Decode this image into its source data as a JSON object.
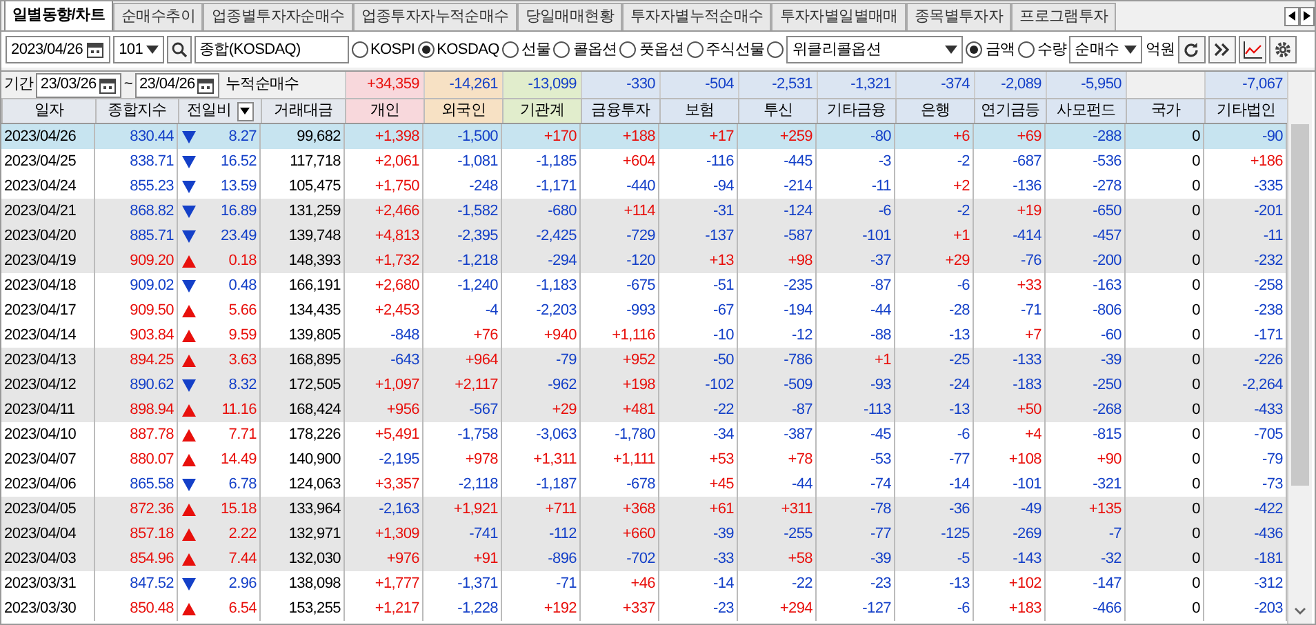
{
  "tabs": [
    {
      "label": "일별동향/차트",
      "selected": true
    },
    {
      "label": "순매수추이",
      "selected": false
    },
    {
      "label": "업종별투자자순매수",
      "selected": false
    },
    {
      "label": "업종투자자누적순매수",
      "selected": false
    },
    {
      "label": "당일매매현황",
      "selected": false
    },
    {
      "label": "투자자별누적순매수",
      "selected": false
    },
    {
      "label": "투자자별일별매매",
      "selected": false
    },
    {
      "label": "종목별투자자",
      "selected": false
    },
    {
      "label": "프로그램투자",
      "selected": false
    }
  ],
  "toolbar": {
    "date": "2023/04/26",
    "code": "101",
    "market_name": "종합(KOSDAQ)",
    "markets": [
      {
        "label": "KOSPI",
        "selected": false
      },
      {
        "label": "KOSDAQ",
        "selected": true
      },
      {
        "label": "선물",
        "selected": false
      },
      {
        "label": "콜옵션",
        "selected": false
      },
      {
        "label": "풋옵션",
        "selected": false
      },
      {
        "label": "주식선물",
        "selected": false
      },
      {
        "selected": false
      }
    ],
    "option_select": "위클리콜옵션",
    "units": [
      {
        "label": "금액",
        "selected": true
      },
      {
        "label": "수량",
        "selected": false
      }
    ],
    "mode_select": "순매수",
    "unit_label": "억원"
  },
  "period": {
    "label": "기간",
    "from": "23/03/26",
    "separator": "~",
    "to": "23/04/26",
    "totals_label": "누적순매수"
  },
  "table": {
    "columns": [
      {
        "label": "일자"
      },
      {
        "label": "종합지수"
      },
      {
        "label": "전일비",
        "kind": "dropdown"
      },
      {
        "label": "거래대금"
      },
      {
        "label": "개인",
        "color": "#f8d8dc"
      },
      {
        "label": "외국인",
        "color": "#f7e1c4"
      },
      {
        "label": "기관계",
        "color": "#e1edcc"
      },
      {
        "label": "금융투자",
        "color": "#dbe5f2"
      },
      {
        "label": "보험",
        "color": "#dbe5f2"
      },
      {
        "label": "투신",
        "color": "#dbe5f2"
      },
      {
        "label": "기타금융",
        "color": "#dbe5f2"
      },
      {
        "label": "은행",
        "color": "#dbe5f2"
      },
      {
        "label": "연기금등",
        "color": "#dbe5f2"
      },
      {
        "label": "사모펀드",
        "color": "#dbe5f2"
      },
      {
        "label": "국가",
        "color": "#dbe5f2"
      },
      {
        "label": "기타법인",
        "color": "#dbe5f2"
      }
    ],
    "totals": [
      {
        "value": "+34,359"
      },
      {
        "value": "-14,261"
      },
      {
        "value": "-13,099"
      },
      {
        "value": "-330"
      },
      {
        "value": "-504"
      },
      {
        "value": "-2,531"
      },
      {
        "value": "-1,321"
      },
      {
        "value": "-374"
      },
      {
        "value": "-2,089"
      },
      {
        "value": "-5,950"
      },
      {
        "blank": true
      },
      {
        "value": "-7,067"
      }
    ],
    "rows": [
      {
        "date": "2023/04/26",
        "index": "830.44",
        "up": false,
        "change": "8.27",
        "volume": "99,682",
        "values": [
          "+1,398",
          "-1,500",
          "+170",
          "+188",
          "+17",
          "+259",
          "-80",
          "+6",
          "+69",
          "-288",
          "0",
          "-90"
        ],
        "selected": true,
        "shaded": false
      },
      {
        "date": "2023/04/25",
        "index": "838.71",
        "up": false,
        "change": "16.52",
        "volume": "117,718",
        "values": [
          "+2,061",
          "-1,081",
          "-1,185",
          "+604",
          "-116",
          "-445",
          "-3",
          "-2",
          "-687",
          "-536",
          "0",
          "+186"
        ],
        "selected": false,
        "shaded": false
      },
      {
        "date": "2023/04/24",
        "index": "855.23",
        "up": false,
        "change": "13.59",
        "volume": "105,475",
        "values": [
          "+1,750",
          "-248",
          "-1,171",
          "-440",
          "-94",
          "-214",
          "-11",
          "+2",
          "-136",
          "-278",
          "0",
          "-335"
        ],
        "selected": false,
        "shaded": false
      },
      {
        "date": "2023/04/21",
        "index": "868.82",
        "up": false,
        "change": "16.89",
        "volume": "131,259",
        "values": [
          "+2,466",
          "-1,582",
          "-680",
          "+114",
          "-31",
          "-124",
          "-6",
          "-2",
          "+19",
          "-650",
          "0",
          "-201"
        ],
        "selected": false,
        "shaded": true
      },
      {
        "date": "2023/04/20",
        "index": "885.71",
        "up": false,
        "change": "23.49",
        "volume": "139,748",
        "values": [
          "+4,813",
          "-2,395",
          "-2,425",
          "-729",
          "-137",
          "-587",
          "-101",
          "+1",
          "-414",
          "-457",
          "0",
          "-11"
        ],
        "selected": false,
        "shaded": true
      },
      {
        "date": "2023/04/19",
        "index": "909.20",
        "up": true,
        "change": "0.18",
        "volume": "148,393",
        "values": [
          "+1,732",
          "-1,218",
          "-294",
          "-120",
          "+13",
          "+98",
          "-37",
          "+29",
          "-76",
          "-200",
          "0",
          "-232"
        ],
        "selected": false,
        "shaded": true
      },
      {
        "date": "2023/04/18",
        "index": "909.02",
        "up": false,
        "change": "0.48",
        "volume": "166,191",
        "values": [
          "+2,680",
          "-1,240",
          "-1,183",
          "-675",
          "-51",
          "-235",
          "-87",
          "-6",
          "+33",
          "-163",
          "0",
          "-258"
        ],
        "selected": false,
        "shaded": false
      },
      {
        "date": "2023/04/17",
        "index": "909.50",
        "up": true,
        "change": "5.66",
        "volume": "134,435",
        "values": [
          "+2,453",
          "-4",
          "-2,203",
          "-993",
          "-67",
          "-194",
          "-44",
          "-28",
          "-71",
          "-806",
          "0",
          "-238"
        ],
        "selected": false,
        "shaded": false
      },
      {
        "date": "2023/04/14",
        "index": "903.84",
        "up": true,
        "change": "9.59",
        "volume": "139,805",
        "values": [
          "-848",
          "+76",
          "+940",
          "+1,116",
          "-10",
          "-12",
          "-88",
          "-13",
          "+7",
          "-60",
          "0",
          "-171"
        ],
        "selected": false,
        "shaded": false
      },
      {
        "date": "2023/04/13",
        "index": "894.25",
        "up": true,
        "change": "3.63",
        "volume": "168,895",
        "values": [
          "-643",
          "+964",
          "-79",
          "+952",
          "-50",
          "-786",
          "+1",
          "-25",
          "-133",
          "-39",
          "0",
          "-226"
        ],
        "selected": false,
        "shaded": true
      },
      {
        "date": "2023/04/12",
        "index": "890.62",
        "up": false,
        "change": "8.32",
        "volume": "172,505",
        "values": [
          "+1,097",
          "+2,117",
          "-962",
          "+198",
          "-102",
          "-509",
          "-93",
          "-24",
          "-183",
          "-250",
          "0",
          "-2,264"
        ],
        "selected": false,
        "shaded": true
      },
      {
        "date": "2023/04/11",
        "index": "898.94",
        "up": true,
        "change": "11.16",
        "volume": "168,424",
        "values": [
          "+956",
          "-567",
          "+29",
          "+481",
          "-22",
          "-87",
          "-113",
          "-13",
          "+50",
          "-268",
          "0",
          "-433"
        ],
        "selected": false,
        "shaded": true
      },
      {
        "date": "2023/04/10",
        "index": "887.78",
        "up": true,
        "change": "7.71",
        "volume": "178,226",
        "values": [
          "+5,491",
          "-1,758",
          "-3,063",
          "-1,780",
          "-34",
          "-387",
          "-45",
          "-6",
          "+4",
          "-815",
          "0",
          "-705"
        ],
        "selected": false,
        "shaded": false
      },
      {
        "date": "2023/04/07",
        "index": "880.07",
        "up": true,
        "change": "14.49",
        "volume": "140,900",
        "values": [
          "-2,195",
          "+978",
          "+1,311",
          "+1,111",
          "+53",
          "+78",
          "-53",
          "-77",
          "+108",
          "+90",
          "0",
          "-79"
        ],
        "selected": false,
        "shaded": false
      },
      {
        "date": "2023/04/06",
        "index": "865.58",
        "up": false,
        "change": "6.78",
        "volume": "124,063",
        "values": [
          "+3,357",
          "-2,118",
          "-1,187",
          "-678",
          "+45",
          "-44",
          "-74",
          "-14",
          "-101",
          "-321",
          "0",
          "-73"
        ],
        "selected": false,
        "shaded": false
      },
      {
        "date": "2023/04/05",
        "index": "872.36",
        "up": true,
        "change": "15.18",
        "volume": "133,964",
        "values": [
          "-2,163",
          "+1,921",
          "+711",
          "+368",
          "+61",
          "+311",
          "-78",
          "-36",
          "-49",
          "+135",
          "0",
          "-422"
        ],
        "selected": false,
        "shaded": true
      },
      {
        "date": "2023/04/04",
        "index": "857.18",
        "up": true,
        "change": "2.22",
        "volume": "132,971",
        "values": [
          "+1,309",
          "-741",
          "-112",
          "+660",
          "-39",
          "-255",
          "-77",
          "-125",
          "-269",
          "-7",
          "0",
          "-436"
        ],
        "selected": false,
        "shaded": true
      },
      {
        "date": "2023/04/03",
        "index": "854.96",
        "up": true,
        "change": "7.44",
        "volume": "132,030",
        "values": [
          "+976",
          "+91",
          "-896",
          "-702",
          "-33",
          "+58",
          "-39",
          "-5",
          "-143",
          "-32",
          "0",
          "-181"
        ],
        "selected": false,
        "shaded": true
      },
      {
        "date": "2023/03/31",
        "index": "847.52",
        "up": false,
        "change": "2.96",
        "volume": "138,098",
        "values": [
          "+1,777",
          "-1,371",
          "-71",
          "+46",
          "-14",
          "-22",
          "-23",
          "-13",
          "+102",
          "-147",
          "0",
          "-312"
        ],
        "selected": false,
        "shaded": false
      },
      {
        "date": "2023/03/30",
        "index": "850.48",
        "up": true,
        "change": "6.54",
        "volume": "153,255",
        "values": [
          "+1,217",
          "-1,228",
          "+192",
          "+337",
          "-23",
          "+294",
          "-127",
          "-6",
          "+183",
          "-466",
          "0",
          "-203"
        ],
        "selected": false,
        "shaded": false
      }
    ]
  }
}
